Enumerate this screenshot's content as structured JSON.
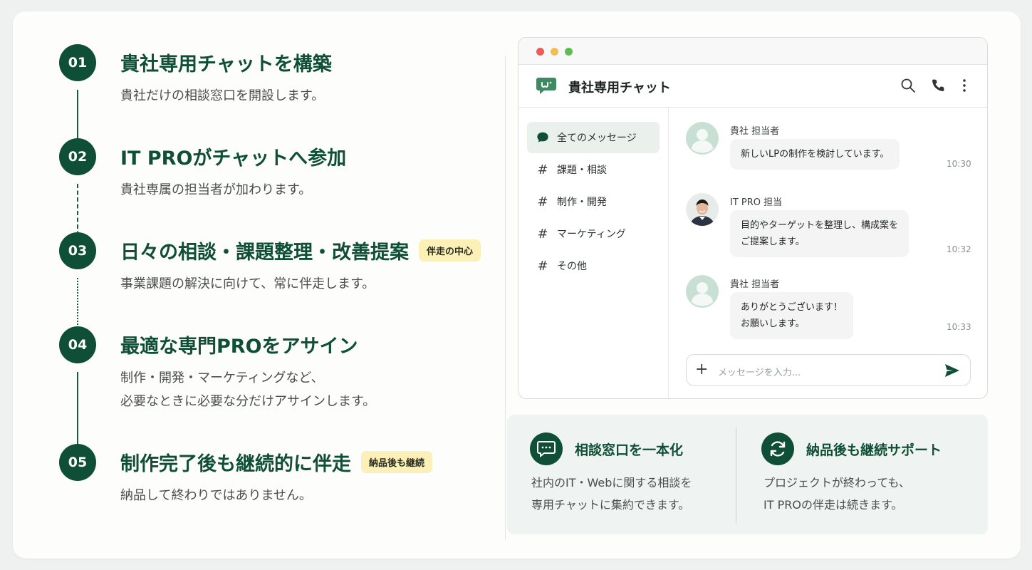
{
  "steps": [
    {
      "num": "01",
      "title": "貴社専用チャットを構築",
      "badge": "",
      "desc": [
        "貴社だけの相談窓口を開設します。"
      ]
    },
    {
      "num": "02",
      "title": "IT PROがチャットへ参加",
      "badge": "",
      "desc": [
        "貴社専属の担当者が加わります。"
      ]
    },
    {
      "num": "03",
      "title": "日々の相談・課題整理・改善提案",
      "badge": "伴走の中心",
      "desc": [
        "事業課題の解決に向けて、常に伴走します。"
      ]
    },
    {
      "num": "04",
      "title": "最適な専門PROをアサイン",
      "badge": "",
      "desc": [
        "制作・開発・マーケティングなど、",
        "必要なときに必要な分だけアサインします。"
      ]
    },
    {
      "num": "05",
      "title": "制作完了後も継続的に伴走",
      "badge": "納品後も継続",
      "desc": [
        "納品して終わりではありません。"
      ]
    }
  ],
  "chat": {
    "title": "貴社専用チャット",
    "icons": [
      "chat-logo-icon",
      "search-icon",
      "phone-icon",
      "more-vertical-icon"
    ],
    "sidebar": [
      {
        "icon": "chat-bubble-icon",
        "label": "全てのメッセージ",
        "active": true
      },
      {
        "icon": "hash-icon",
        "label": "課題・相談",
        "active": false
      },
      {
        "icon": "hash-icon",
        "label": "制作・開発",
        "active": false
      },
      {
        "icon": "hash-icon",
        "label": "マーケティング",
        "active": false
      },
      {
        "icon": "hash-icon",
        "label": "その他",
        "active": false
      }
    ],
    "messages": [
      {
        "sender": "貴社 担当者",
        "lines": [
          "新しいLPの制作を検討しています。"
        ],
        "time": "10:30",
        "avatar": "user-placeholder-icon"
      },
      {
        "sender": "IT PRO 担当",
        "lines": [
          "目的やターゲットを整理し、構成案を",
          "ご提案します。"
        ],
        "time": "10:32",
        "avatar": "staff-photo"
      },
      {
        "sender": "貴社 担当者",
        "lines": [
          "ありがとうございます！",
          "お願いします。"
        ],
        "time": "10:33",
        "avatar": "user-placeholder-icon"
      }
    ],
    "input_placeholder": "メッセージを入力..."
  },
  "features": [
    {
      "icon": "chat-icon",
      "title": "相談窓口を一本化",
      "desc": [
        "社内のIT・Webに関する相談を",
        "専用チャットに集約できます。"
      ]
    },
    {
      "icon": "refresh-icon",
      "title": "納品後も継続サポート",
      "desc": [
        "プロジェクトが終わっても、",
        "IT PROの伴走は続きます。"
      ]
    }
  ],
  "colors": {
    "primary": "#0f4f38",
    "badge_bg": "#fbf1b8",
    "panel_bg": "#eff3f1"
  }
}
